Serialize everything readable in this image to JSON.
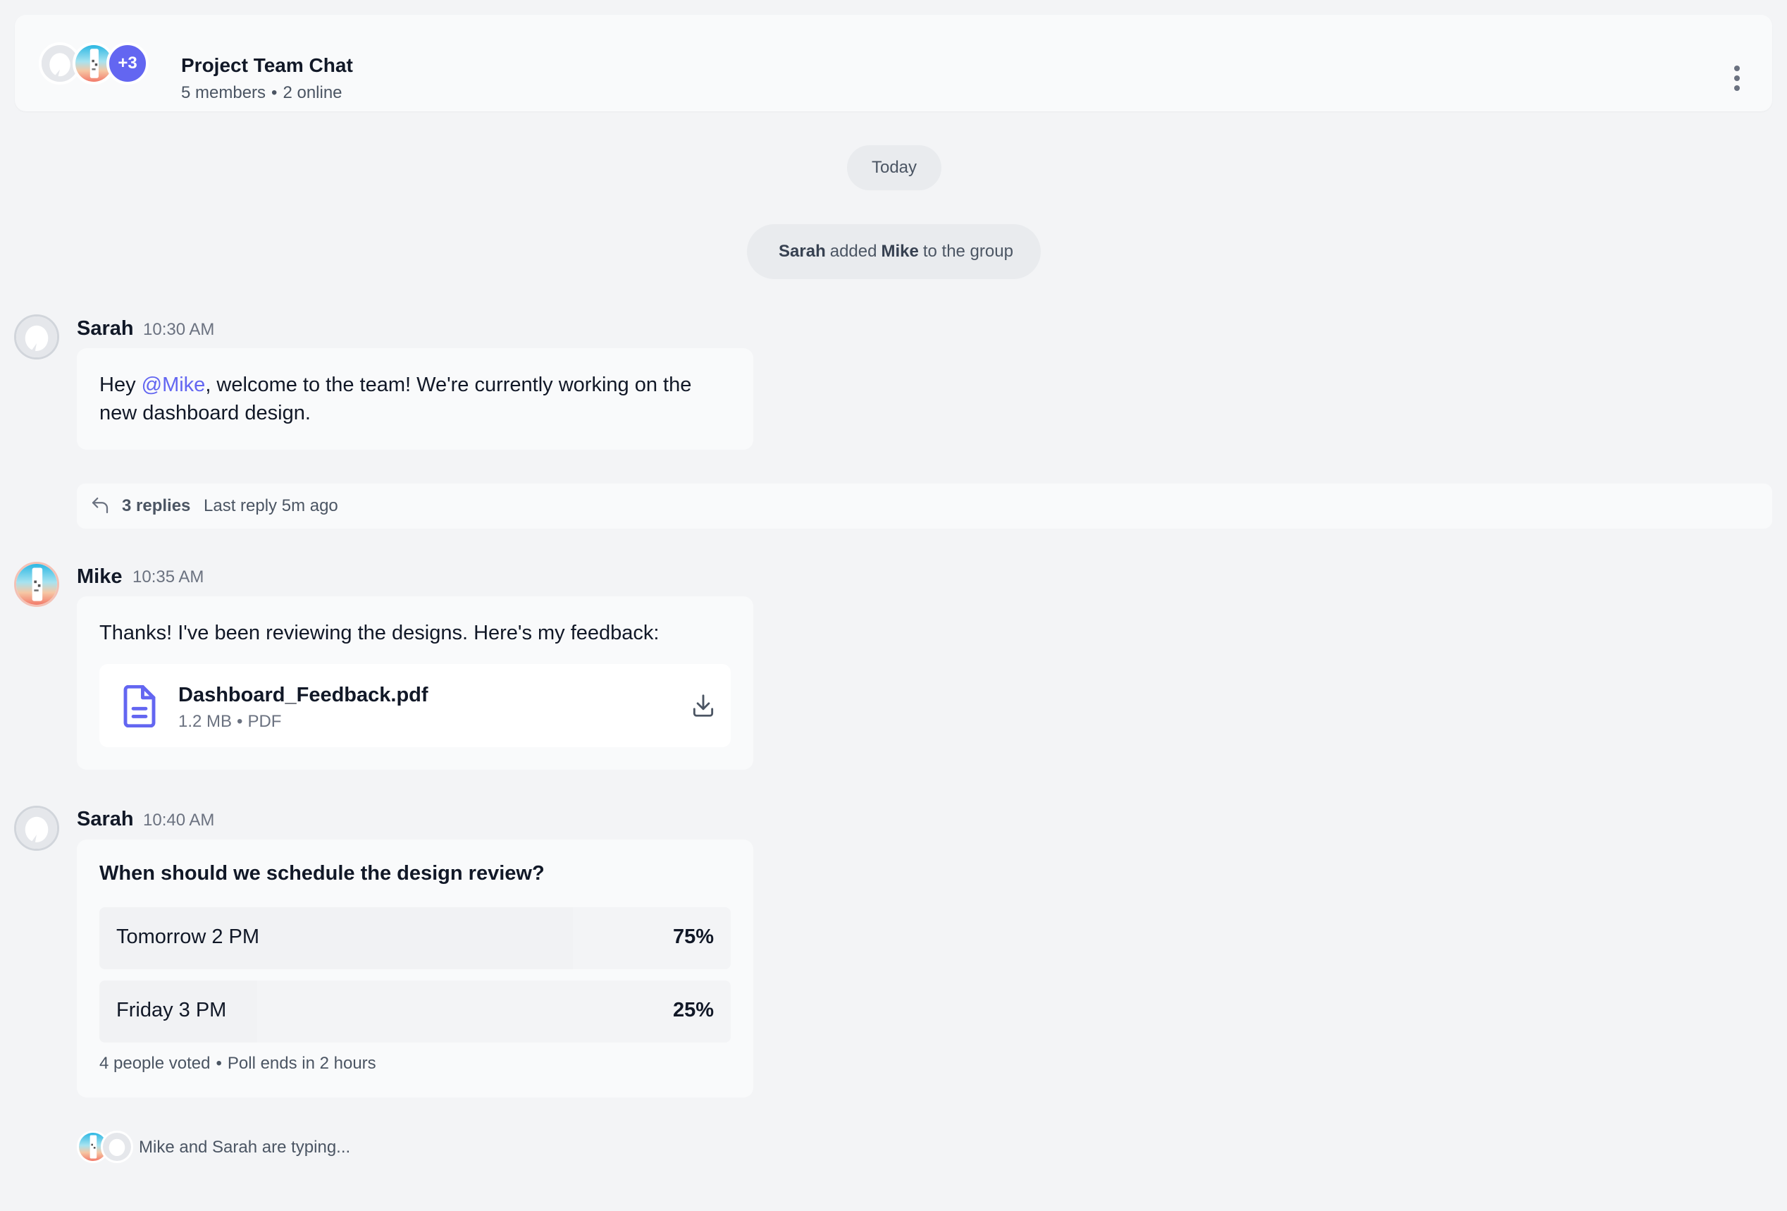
{
  "header": {
    "title": "Project Team Chat",
    "members": "5 members",
    "online": "2 online",
    "more_count": "+3"
  },
  "timeline": {
    "date_divider": "Today",
    "system_message": {
      "actor": "Sarah",
      "action": "added",
      "target": "Mike",
      "suffix": "to the group"
    }
  },
  "messages": [
    {
      "sender": "Sarah",
      "time": "10:30 AM",
      "text_before": "Hey ",
      "mention": "@Mike",
      "text_after": ", welcome to the team! We're currently working on the new dashboard design.",
      "thread": {
        "replies": "3 replies",
        "last_reply": "Last reply 5m ago"
      }
    },
    {
      "sender": "Mike",
      "time": "10:35 AM",
      "text": "Thanks! I've been reviewing the designs. Here's my feedback:",
      "attachment": {
        "name": "Dashboard_Feedback.pdf",
        "size": "1.2 MB",
        "type": "PDF",
        "icon": "document-icon"
      }
    },
    {
      "sender": "Sarah",
      "time": "10:40 AM",
      "poll": {
        "question": "When should we schedule the design review?",
        "options": [
          {
            "label": "Tomorrow 2 PM",
            "percent_label": "75%",
            "percent": 75
          },
          {
            "label": "Friday 3 PM",
            "percent_label": "25%",
            "percent": 25
          }
        ],
        "votes": "4 people voted",
        "ends": "Poll ends in 2 hours"
      }
    }
  ],
  "typing_indicator": "Mike and Sarah are typing...",
  "colors": {
    "accent": "#6366f1",
    "background": "#f3f4f6",
    "card": "#f9fafb"
  }
}
